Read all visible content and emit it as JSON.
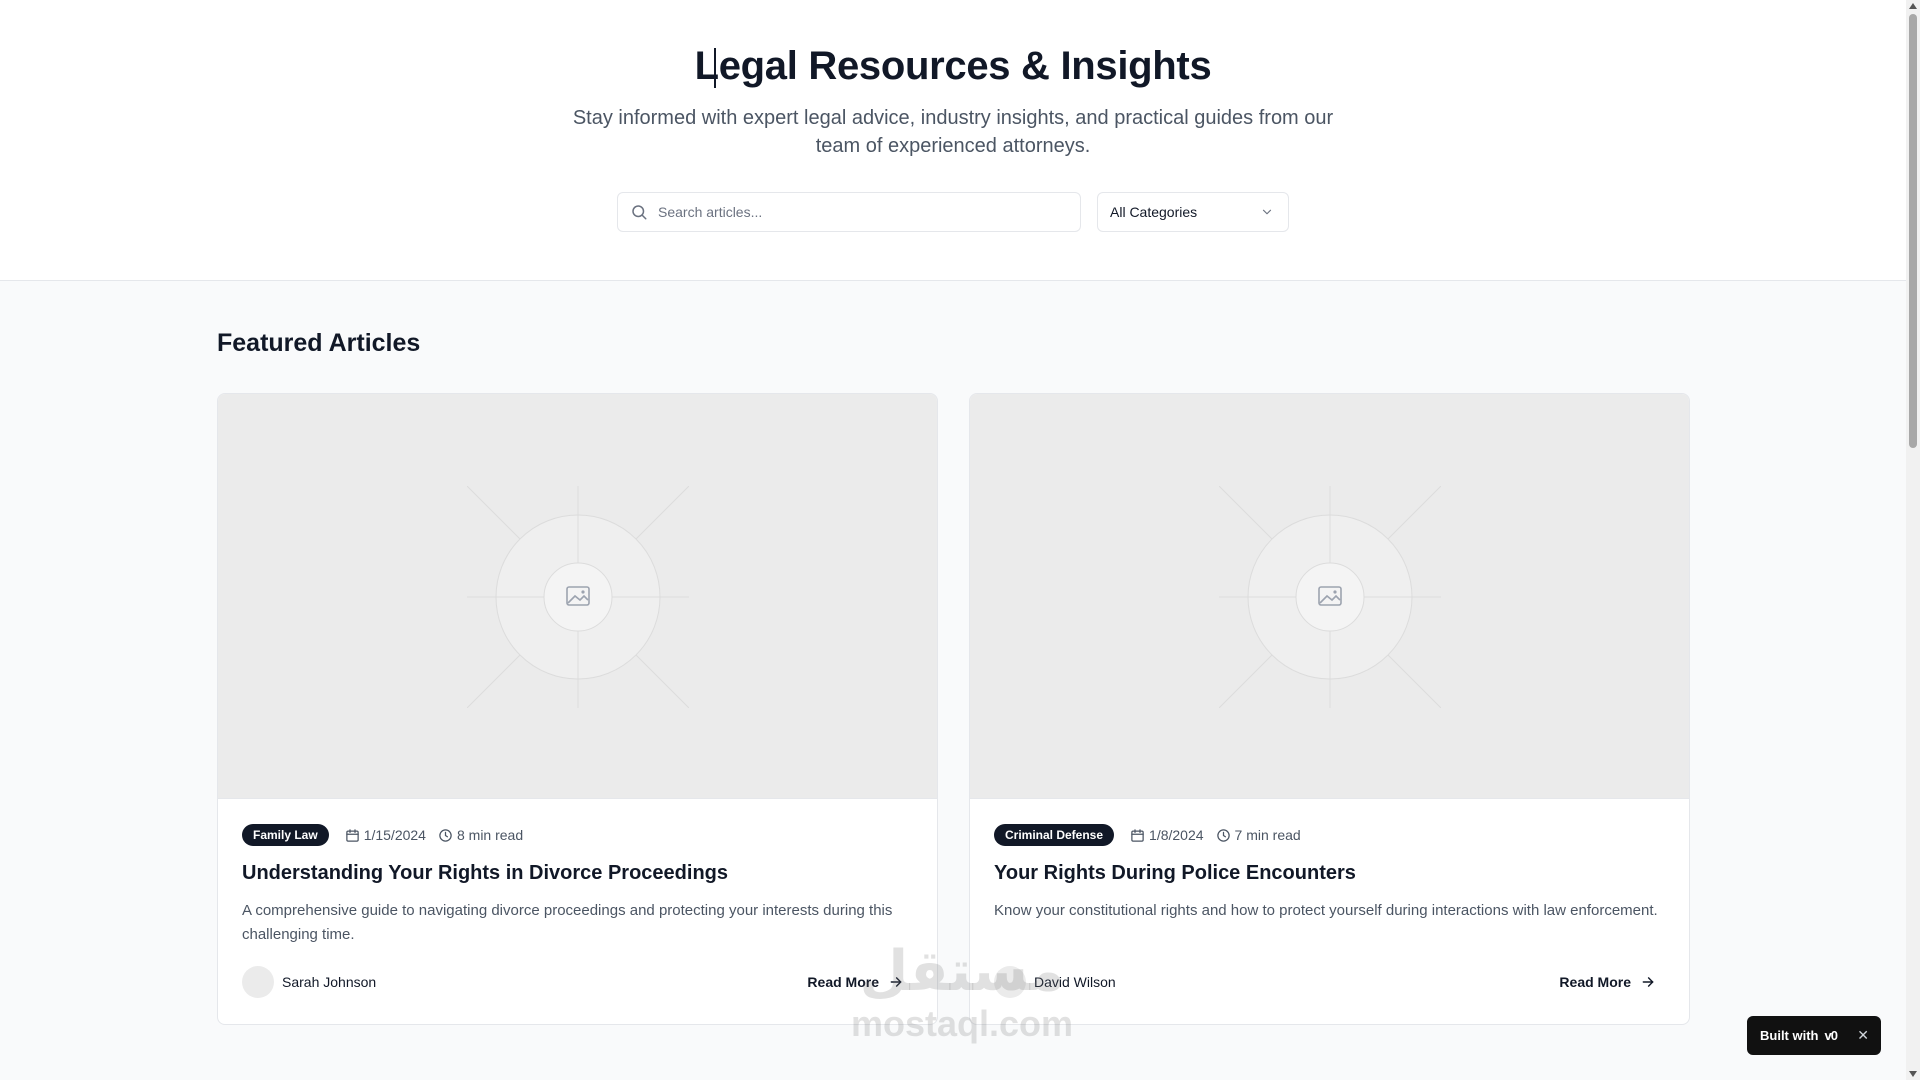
{
  "hero": {
    "title": "Legal Resources & Insights",
    "subtitle": "Stay informed with expert legal advice, industry insights, and practical guides from our team of experienced attorneys.",
    "search_placeholder": "Search articles...",
    "category_selected": "All Categories"
  },
  "featured": {
    "title": "Featured Articles",
    "articles": [
      {
        "category": "Family Law",
        "date": "1/15/2024",
        "read_time": "8 min read",
        "title": "Understanding Your Rights in Divorce Proceedings",
        "excerpt": "A comprehensive guide to navigating divorce proceedings and protecting your interests during this challenging time.",
        "author": "Sarah Johnson",
        "cta": "Read More"
      },
      {
        "category": "Criminal Defense",
        "date": "1/8/2024",
        "read_time": "7 min read",
        "title": "Your Rights During Police Encounters",
        "excerpt": "Know your constitutional rights and how to protect yourself during interactions with law enforcement.",
        "author": "David Wilson",
        "cta": "Read More"
      }
    ]
  },
  "watermark": {
    "arabic": "مستقل",
    "latin": "mostaql.com"
  },
  "built_with": {
    "label": "Built with",
    "brand": "v0"
  },
  "colors": {
    "text": "#111827",
    "muted": "#4b5563",
    "border": "#e5e7eb",
    "page_bg": "#f9fafb",
    "placeholder_bg": "#ebebeb"
  }
}
